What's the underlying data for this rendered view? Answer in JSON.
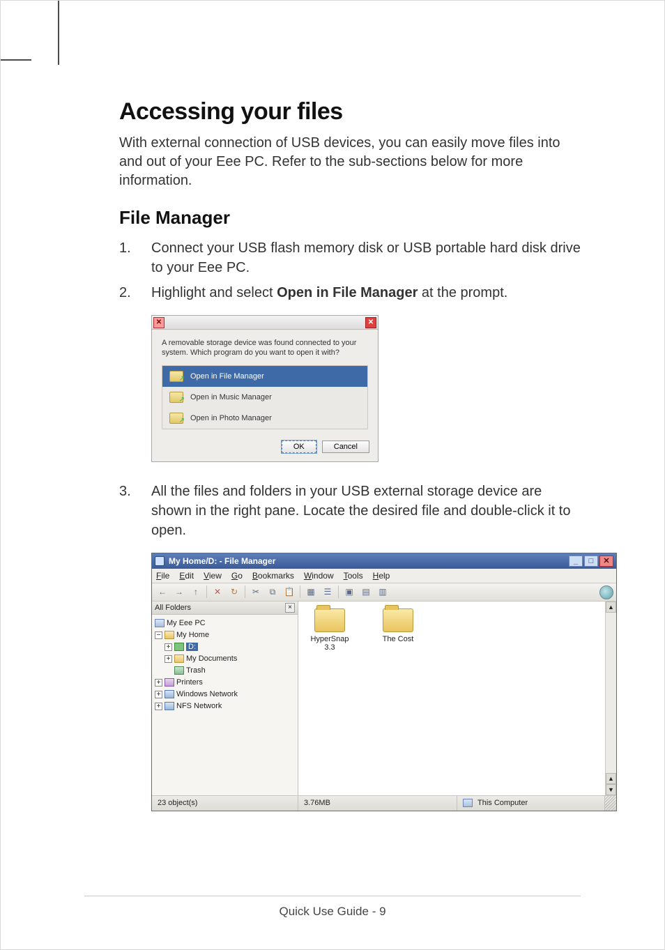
{
  "heading": "Accessing your files",
  "intro": "With external connection of USB devices, you can easily move files into and out of your Eee PC. Refer to the sub-sections below for more information.",
  "subheading": "File Manager",
  "steps": {
    "s1_num": "1.",
    "s1": "Connect your USB flash memory disk or USB portable hard disk drive to your Eee PC.",
    "s2_num": "2.",
    "s2_pre": "Highlight and select ",
    "s2_bold": "Open in File Manager",
    "s2_post": " at the prompt.",
    "s3_num": "3.",
    "s3": "All the files and folders in your USB external storage device are shown in the right pane. Locate the desired file and double-click it to open."
  },
  "dialog": {
    "message": "A removable storage device was found connected to your system. Which program do you want to open it with?",
    "options": [
      "Open in File Manager",
      "Open in Music Manager",
      "Open in Photo Manager"
    ],
    "ok": "OK",
    "cancel": "Cancel"
  },
  "fm": {
    "title": "My Home/D: - File Manager",
    "menus": {
      "file": "File",
      "edit": "Edit",
      "view": "View",
      "go": "Go",
      "bookmarks": "Bookmarks",
      "window": "Window",
      "tools": "Tools",
      "help": "Help"
    },
    "tree_header": "All Folders",
    "tree": {
      "root": "My Eee PC",
      "home": "My Home",
      "drive": "D:",
      "docs": "My Documents",
      "trash": "Trash",
      "printers": "Printers",
      "winnet": "Windows Network",
      "nfsnet": "NFS Network"
    },
    "items": [
      {
        "name_line1": "HyperSnap",
        "name_line2": "3.3"
      },
      {
        "name_line1": "The Cost",
        "name_line2": ""
      }
    ],
    "status": {
      "objects": "23 object(s)",
      "size": "3.76MB",
      "location": "This Computer"
    }
  },
  "footer": "Quick Use Guide - 9"
}
